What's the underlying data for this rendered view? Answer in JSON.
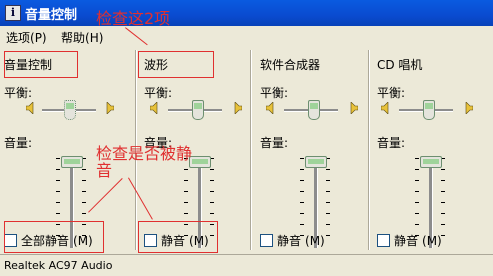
{
  "window": {
    "title": "音量控制",
    "icon": "info-app-icon"
  },
  "menu": [
    {
      "label": "选项",
      "accel": "(P)"
    },
    {
      "label": "帮助",
      "accel": "(H)"
    }
  ],
  "channels": [
    {
      "title": "音量控制",
      "balance_label": "平衡:",
      "volume_label": "音量:",
      "mute_label": "全部静音",
      "mute_accel": "(M)",
      "muted": false
    },
    {
      "title": "波形",
      "balance_label": "平衡:",
      "volume_label": "音量:",
      "mute_label": "静音",
      "mute_accel": "(M)",
      "muted": false
    },
    {
      "title": "软件合成器",
      "balance_label": "平衡:",
      "volume_label": "音量:",
      "mute_label": "静音",
      "mute_accel": "(M)",
      "muted": false
    },
    {
      "title": "CD 唱机",
      "balance_label": "平衡:",
      "volume_label": "音量:",
      "mute_label": "静音",
      "mute_accel": "(M)",
      "muted": false
    }
  ],
  "status": {
    "device": "Realtek AC97 Audio"
  },
  "annotations": {
    "top": "检查这2项",
    "middle": "检查是否被静音",
    "color": "#e03030"
  }
}
